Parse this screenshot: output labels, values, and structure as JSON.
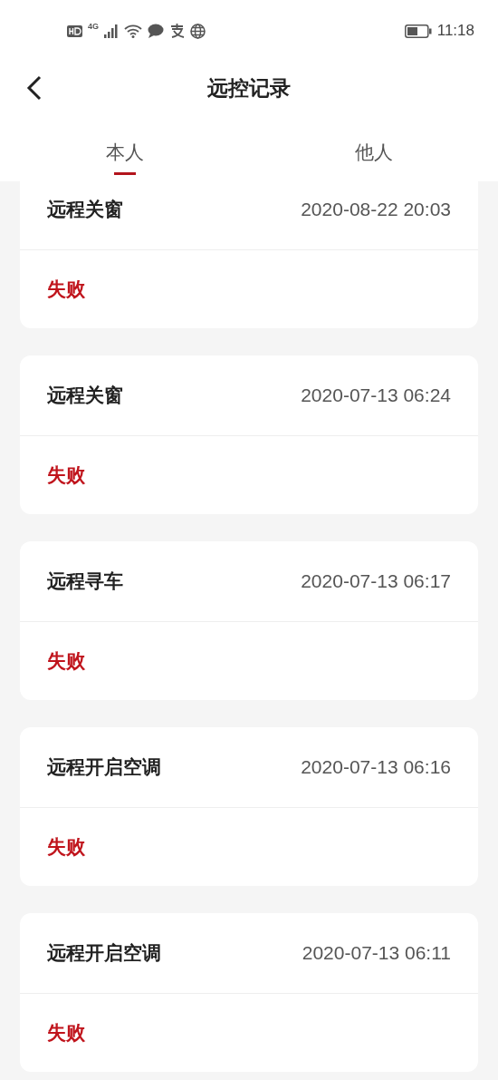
{
  "status_bar": {
    "time": "11:18",
    "network": "4G"
  },
  "header": {
    "title": "远控记录"
  },
  "tabs": [
    {
      "label": "本人",
      "selected": true
    },
    {
      "label": "他人",
      "selected": false
    }
  ],
  "records": [
    {
      "action": "远程关窗",
      "time": "2020-08-22 20:03",
      "result": "失败"
    },
    {
      "action": "远程关窗",
      "time": "2020-07-13 06:24",
      "result": "失败"
    },
    {
      "action": "远程寻车",
      "time": "2020-07-13 06:17",
      "result": "失败"
    },
    {
      "action": "远程开启空调",
      "time": "2020-07-13 06:16",
      "result": "失败"
    },
    {
      "action": "远程开启空调",
      "time": "2020-07-13 06:11",
      "result": "失败"
    }
  ]
}
